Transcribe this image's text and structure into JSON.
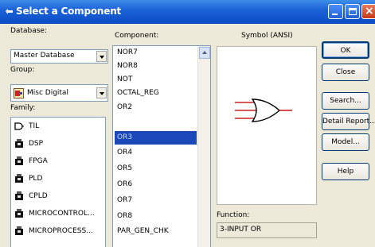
{
  "window": {
    "title": "Select a Component",
    "controls": {
      "minimize": "minimize-icon",
      "maximize": "maximize-icon",
      "close": "close-icon"
    }
  },
  "database": {
    "label": "Database:",
    "value": "Master Database"
  },
  "group": {
    "label": "Group:",
    "value": "Misc Digital"
  },
  "family": {
    "label": "Family:",
    "items": [
      {
        "label": "TIL"
      },
      {
        "label": "DSP"
      },
      {
        "label": "FPGA"
      },
      {
        "label": "PLD"
      },
      {
        "label": "CPLD"
      },
      {
        "label": "MICROCONTROL..."
      },
      {
        "label": "MICROPROCESS..."
      }
    ]
  },
  "component": {
    "label": "Component:",
    "items": [
      {
        "label": "NOR7"
      },
      {
        "label": "NOR8"
      },
      {
        "label": "NOT"
      },
      {
        "label": "OCTAL_REG"
      },
      {
        "label": "OR2"
      },
      {
        "label": "OR3",
        "selected": true
      },
      {
        "label": "OR4"
      },
      {
        "label": "OR5"
      },
      {
        "label": "OR6"
      },
      {
        "label": "OR7"
      },
      {
        "label": "OR8"
      },
      {
        "label": "PAR_GEN_CHK"
      }
    ]
  },
  "symbol": {
    "label": "Symbol (ANSI)",
    "icon": "or-gate-icon",
    "input_color": "#cc2222",
    "output_color": "#cc2222"
  },
  "function": {
    "label": "Function:",
    "value": "3-INPUT OR"
  },
  "buttons": {
    "ok": "OK",
    "close": "Close",
    "search": "Search...",
    "detail_report": "Detail Report...",
    "model": "Model...",
    "help": "Help"
  },
  "colors": {
    "titlebar": "#1d63d8",
    "selection": "#1a48b8",
    "dialog_bg": "#ece9d8"
  }
}
